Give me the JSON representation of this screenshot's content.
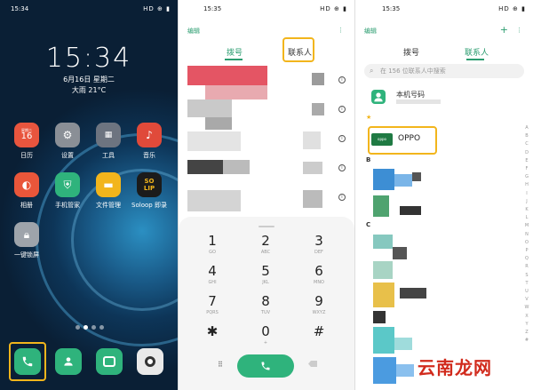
{
  "home": {
    "status_time": "15:34",
    "status_right": "HD ⊕ ▮",
    "clock": "15:34",
    "date": "6月16日 星期二",
    "weather": "大雨 21°C",
    "apps": [
      {
        "label": "日历",
        "icon": "calendar-icon",
        "badge": "16",
        "color": "#e8553e"
      },
      {
        "label": "设置",
        "icon": "gear-icon",
        "color": "#8a8f96"
      },
      {
        "label": "工具",
        "icon": "folder-icon",
        "color": "#6d7480"
      },
      {
        "label": "音乐",
        "icon": "music-icon",
        "color": "#e04a3a"
      },
      {
        "label": "相册",
        "icon": "gallery-icon",
        "color": "#e9563a"
      },
      {
        "label": "手机管家",
        "icon": "shield-icon",
        "color": "#2fb37c"
      },
      {
        "label": "文件管理",
        "icon": "file-icon",
        "color": "#f2b51c"
      },
      {
        "label": "Soloop 即录",
        "icon": "soloop-icon",
        "color": "#1b1b1b"
      },
      {
        "label": "一键锁屏",
        "icon": "lock-icon",
        "color": "#9ea4ab"
      }
    ],
    "soloop_text": "SO\nLIP"
  },
  "dialer": {
    "status_time": "15:35",
    "edit": "编辑",
    "tab_dial": "拨号",
    "tab_contacts": "联系人",
    "keys": [
      {
        "d": "1",
        "l": "GO"
      },
      {
        "d": "2",
        "l": "ABC"
      },
      {
        "d": "3",
        "l": "DEF"
      },
      {
        "d": "4",
        "l": "GHI"
      },
      {
        "d": "5",
        "l": "JKL"
      },
      {
        "d": "6",
        "l": "MNO"
      },
      {
        "d": "7",
        "l": "PQRS"
      },
      {
        "d": "8",
        "l": "TUV"
      },
      {
        "d": "9",
        "l": "WXYZ"
      },
      {
        "d": "✱",
        "l": ""
      },
      {
        "d": "0",
        "l": "+"
      },
      {
        "d": "#",
        "l": ""
      }
    ]
  },
  "contacts": {
    "status_time": "15:35",
    "edit": "编辑",
    "tab_dial": "拨号",
    "tab_contacts": "联系人",
    "search_placeholder": "在 156 位联系人中搜索",
    "my_number": "本机号码",
    "star": "★",
    "oppo": "OPPO",
    "oppo_logo": "oppo",
    "letters": [
      "B",
      "C"
    ],
    "index": [
      "A",
      "B",
      "C",
      "D",
      "E",
      "F",
      "G",
      "H",
      "I",
      "J",
      "K",
      "L",
      "M",
      "N",
      "O",
      "P",
      "Q",
      "R",
      "S",
      "T",
      "U",
      "V",
      "W",
      "X",
      "Y",
      "Z",
      "#"
    ]
  },
  "watermark": "云南龙网",
  "colors": {
    "accent": "#2a9c6f",
    "highlight": "#f2b51c",
    "call": "#2fb37c"
  }
}
